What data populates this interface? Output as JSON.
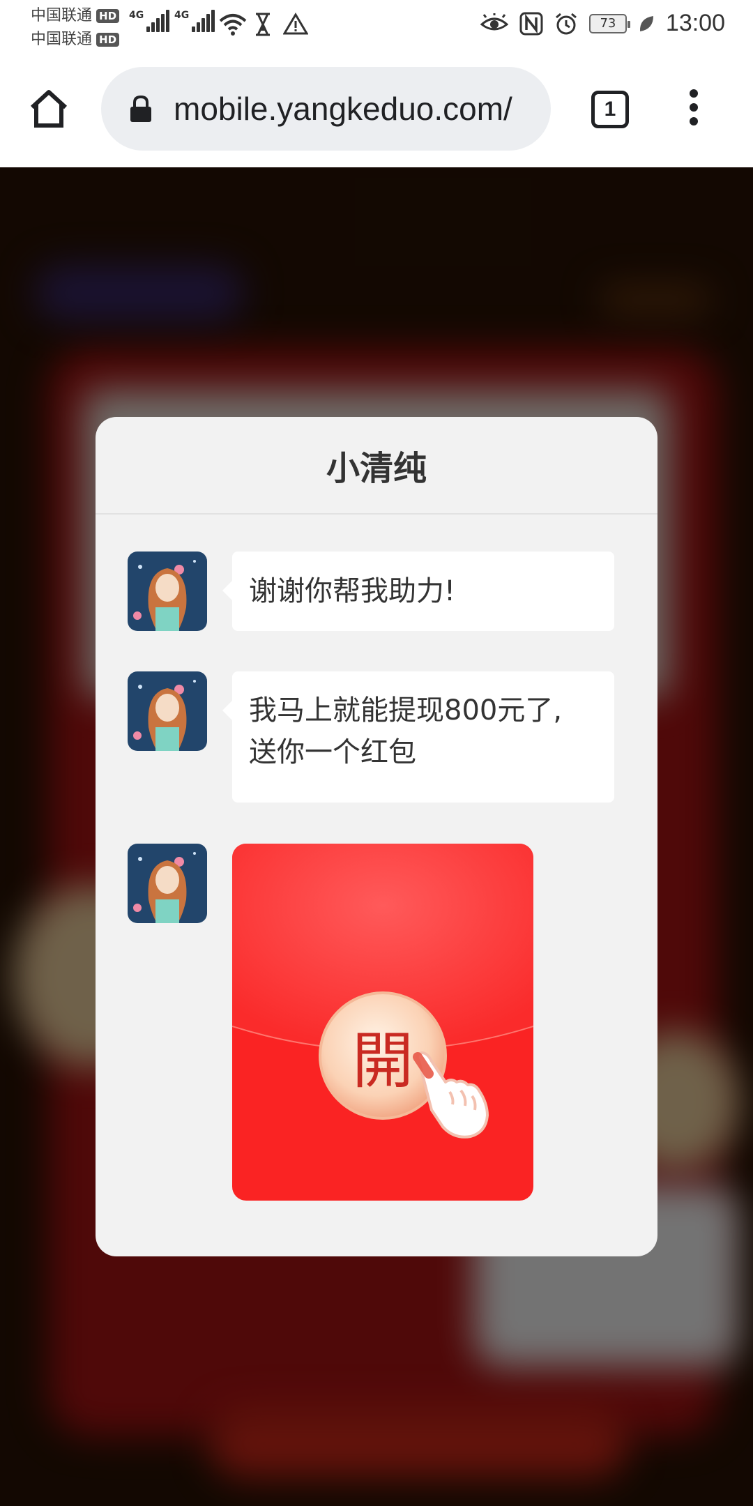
{
  "status_bar": {
    "carrier_1": "中国联通",
    "carrier_2": "中国联通",
    "hd_badge": "HD",
    "network_type": "4G",
    "battery_level": "73",
    "time": "13:00"
  },
  "browser": {
    "url": "mobile.yangkeduo.com/",
    "tab_count": "1"
  },
  "dialog": {
    "title": "小清纯",
    "messages": [
      {
        "text": "谢谢你帮我助力!"
      },
      {
        "text_line1": "我马上就能提现800元了,",
        "text_line2": "送你一个红包"
      }
    ],
    "red_packet": {
      "open_label": "開"
    }
  },
  "colors": {
    "accent_red": "#fa2b2b",
    "modal_bg": "#f2f2f2",
    "bubble_bg": "#ffffff"
  }
}
